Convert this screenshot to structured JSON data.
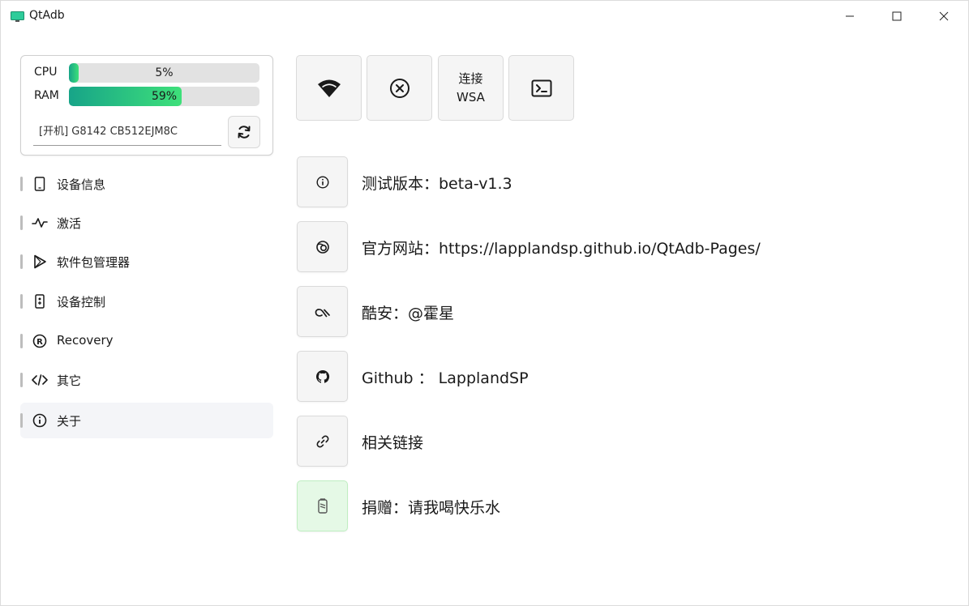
{
  "window": {
    "title": "QtAdb"
  },
  "status": {
    "cpu_label": "CPU",
    "cpu_value": "5%",
    "cpu_fraction": 0.05,
    "ram_label": "RAM",
    "ram_value": "59%",
    "ram_fraction": 0.59,
    "device": "[开机] G8142 CB512EJM8C"
  },
  "sidebar": {
    "items": [
      {
        "label": "设备信息",
        "icon": "phone-icon"
      },
      {
        "label": "激活",
        "icon": "pulse-icon"
      },
      {
        "label": "软件包管理器",
        "icon": "play-icon"
      },
      {
        "label": "设备控制",
        "icon": "remote-icon"
      },
      {
        "label": "Recovery",
        "icon": "recovery-icon"
      },
      {
        "label": "其它",
        "icon": "code-icon"
      },
      {
        "label": "关于",
        "icon": "info-icon",
        "active": true
      }
    ]
  },
  "toolbar": {
    "wsa_line1": "连接",
    "wsa_line2": "WSA"
  },
  "about": {
    "version": "测试版本：beta-v1.3",
    "website": "官方网站：https://lapplandsp.github.io/QtAdb-Pages/",
    "coolapk": "酷安：@霍星",
    "github": "Github ： LapplandSP",
    "links": "相关链接",
    "donate": "捐赠：请我喝快乐水"
  },
  "colors": {
    "accent_start": "#17a488",
    "accent_end": "#3ee07a",
    "donate_bg": "#e5f9e6"
  }
}
